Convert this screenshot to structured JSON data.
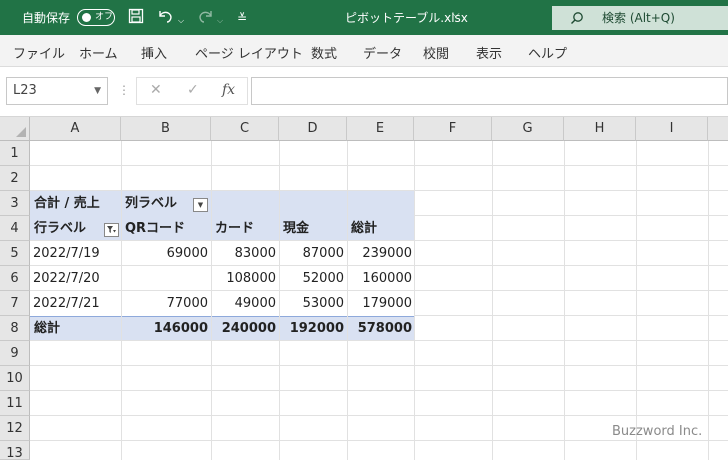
{
  "titlebar": {
    "autosave_label": "自動保存",
    "toggle_state": "オフ",
    "filename": "ピボットテーブル.xlsx",
    "search_text": "検索 (Alt+Q)",
    "icons": [
      "save-icon",
      "undo-icon",
      "redo-icon",
      "customize-icon",
      "search-icon"
    ]
  },
  "menu": [
    "ファイル",
    "ホーム",
    "挿入",
    "ページ レイアウト",
    "数式",
    "データ",
    "校閲",
    "表示",
    "ヘルプ"
  ],
  "formula_bar": {
    "name_box": "L23",
    "cancel_glyph": "✕",
    "enter_glyph": "✓",
    "fx_label": "fx",
    "formula": ""
  },
  "columns": [
    "A",
    "B",
    "C",
    "D",
    "E",
    "F",
    "G",
    "H",
    "I"
  ],
  "rows": [
    "1",
    "2",
    "3",
    "4",
    "5",
    "6",
    "7",
    "8",
    "9",
    "10",
    "11",
    "12",
    "13"
  ],
  "pivot": {
    "header": {
      "a": "合計 / 売上",
      "b": "列ラベル"
    },
    "subheader": {
      "a": "行ラベル",
      "b": "QRコード",
      "c": "カード",
      "d": "現金",
      "e": "総計"
    },
    "data_rows": [
      {
        "a": "2022/7/19",
        "b": "69000",
        "c": "83000",
        "d": "87000",
        "e": "239000"
      },
      {
        "a": "2022/7/20",
        "b": "",
        "c": "108000",
        "d": "52000",
        "e": "160000"
      },
      {
        "a": "2022/7/21",
        "b": "77000",
        "c": "49000",
        "d": "53000",
        "e": "179000"
      }
    ],
    "total": {
      "a": "総計",
      "b": "146000",
      "c": "240000",
      "d": "192000",
      "e": "578000"
    }
  },
  "watermark": "Buzzword Inc.",
  "colors": {
    "title_bar": "#217346",
    "pivot_band": "#d9e1f2",
    "pivot_border": "#8ea9db"
  }
}
